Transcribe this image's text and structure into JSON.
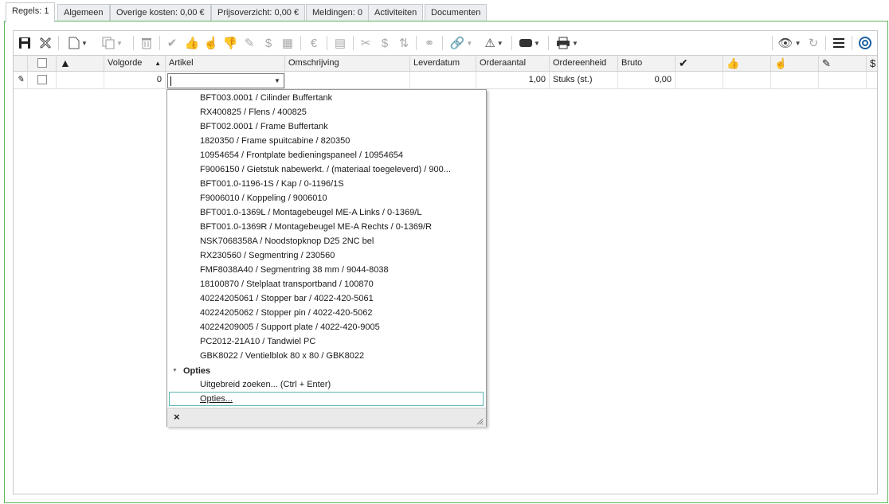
{
  "tabs": [
    {
      "label": "Regels: 1",
      "active": true
    },
    {
      "label": "Algemeen"
    },
    {
      "label": "Overige kosten: 0,00 €"
    },
    {
      "label": "Prijsoverzicht: 0,00 €"
    },
    {
      "label": "Meldingen: 0"
    },
    {
      "label": "Activiteiten"
    },
    {
      "label": "Documenten"
    }
  ],
  "toolbar": {
    "icons": [
      "save-icon",
      "discard-icon",
      "new-icon",
      "copy-icon",
      "delete-icon",
      "thumbs-icons",
      "warning-icon",
      "link-icon",
      "print-icon",
      "view-icon",
      "refresh-icon",
      "menu-icon",
      "help-icon"
    ]
  },
  "grid": {
    "columns": {
      "volgorde": "Volgorde",
      "artikel": "Artikel",
      "omschrijving": "Omschrijving",
      "leverdatum": "Leverdatum",
      "orderaantal": "Orderaantal",
      "ordereenheid": "Ordereenheid",
      "bruto": "Bruto"
    },
    "row": {
      "volgorde": "0",
      "artikel": "",
      "omschrijving": "",
      "leverdatum": "",
      "orderaantal": "1,00",
      "ordereenheid": "Stuks (st.)",
      "bruto": "0,00"
    }
  },
  "dropdown": {
    "items": [
      "BFT003.0001 / Cilinder Buffertank",
      "RX400825 / Flens / 400825",
      "BFT002.0001 / Frame Buffertank",
      "1820350 / Frame spuitcabine / 820350",
      "10954654 / Frontplate bedieningspaneel / 10954654",
      "F9006150 / Gietstuk nabewerkt. / (materiaal toegeleverd) / 900...",
      "BFT001.0-1196-1S / Kap / 0-1196/1S",
      "F9006010 / Koppeling / 9006010",
      "BFT001.0-1369L / Montagebeugel ME-A Links / 0-1369/L",
      "BFT001.0-1369R / Montagebeugel ME-A Rechts / 0-1369/R",
      "NSK7068358A / Noodstopknop D25 2NC bel",
      "RX230560 / Segmentring / 230560",
      "FMF8038A40 / Segmentring 38 mm / 9044-8038",
      "18100870 / Stelplaat transportband / 100870",
      "40224205061 / Stopper bar / 4022-420-5061",
      "40224205062 / Stopper pin / 4022-420-5062",
      "40224209005 / Support plate / 4022-420-9005",
      "PC2012-21A10 / Tandwiel PC",
      "GBK8022 / Ventielblok 80 x 80 / GBK8022"
    ],
    "options_group": "Opties",
    "options": [
      "Uitgebreid zoeken... (Ctrl + Enter)",
      "Opties..."
    ],
    "close_label": "×"
  },
  "colors": {
    "frame_border": "#5cb85c",
    "focus_border": "#5ab5b5"
  }
}
